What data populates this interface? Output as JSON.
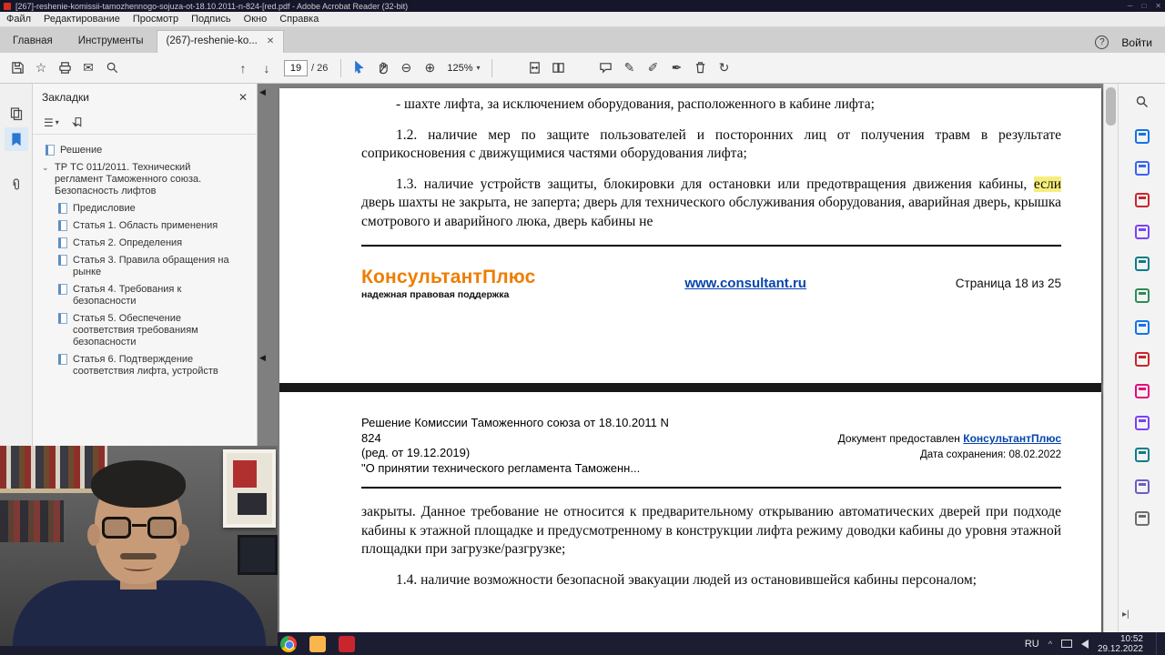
{
  "colors": {
    "brand_orange": "#EF7D00",
    "link_blue": "#0645AD",
    "highlight_yellow": "#F6EE7C",
    "titlebar_bg": "#16162B",
    "taskbar_bg": "#1D1D31",
    "selection_blue": "#2A76D2"
  },
  "window": {
    "title": "[267]-reshenie-komissii-tamozhennogo-sojuza-ot-18.10.2011-n-824-[red.pdf - Adobe Acrobat Reader (32-bit)",
    "menu": [
      "Файл",
      "Редактирование",
      "Просмотр",
      "Подпись",
      "Окно",
      "Справка"
    ],
    "controls": {
      "minimize": "─",
      "maximize": "□",
      "close": "✕"
    }
  },
  "tabbar": {
    "home": "Главная",
    "tools": "Инструменты",
    "document_tab": "(267)-reshenie-ko...",
    "close_tab": "✕",
    "help": "?",
    "sign_in": "Войти"
  },
  "toolbar": {
    "page_current": "19",
    "page_total": "/ 26",
    "zoom_level": "125%"
  },
  "bookmarks_panel": {
    "title": "Закладки",
    "close": "✕",
    "items": [
      {
        "label": "Решение"
      },
      {
        "label": "ТР ТС 011/2011. Технический регламент Таможенного союза. Безопасность лифтов"
      },
      {
        "label": "Предисловие"
      },
      {
        "label": "Статья 1. Область применения"
      },
      {
        "label": "Статья 2. Определения"
      },
      {
        "label": "Статья 3. Правила обращения на рынке"
      },
      {
        "label": "Статья 4. Требования к безопасности"
      },
      {
        "label": "Статья 5. Обеспечение соответствия требованиям безопасности"
      },
      {
        "label": "Статья 6. Подтверждение соответствия лифта, устройств"
      }
    ]
  },
  "page1": {
    "para1": "- шахте лифта, за исключением оборудования, расположенного в кабине лифта;",
    "para2": "1.2. наличие мер по защите пользователей и посторонних лиц от получения травм в результате соприкосновения с движущимися частями оборудования лифта;",
    "para3_before": "1.3. наличие устройств защиты, блокировки для остановки или предотвращения движения кабины, ",
    "para3_highlight": "если",
    "para3_after": " дверь шахты не закрыта, не заперта; дверь для технического обслуживания оборудования, аварийная дверь, крышка смотрового и аварийного люка, дверь кабины не",
    "footer_brand": "КонсультантПлюс",
    "footer_tagline": "надежная правовая поддержка",
    "footer_url": "www.consultant.ru",
    "footer_page_info": "Страница  18 из 25"
  },
  "page2": {
    "header_lines": [
      "Решение Комиссии Таможенного союза от 18.10.2011 N",
      "824",
      "(ред. от 19.12.2019)",
      "\"О принятии технического регламента Таможенн..."
    ],
    "provided_prefix": "Документ предоставлен ",
    "provided_link": "КонсультантПлюс",
    "saved_date": "Дата сохранения: 08.02.2022",
    "para1": "закрыты. Данное требование не относится к предварительному открыванию автоматических дверей при подходе кабины к этажной площадке и предусмотренному в конструкции лифта режиму доводки кабины до уровня этажной площадки при загрузке/разгрузке;",
    "para2": "1.4. наличие возможности безопасной эвакуации людей из остановившейся кабины персоналом;"
  },
  "taskbar": {
    "lang": "RU",
    "tray_chevron": "^",
    "time": "10:52",
    "date": "29.12.2022"
  }
}
